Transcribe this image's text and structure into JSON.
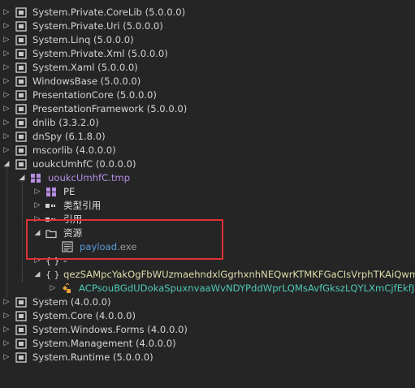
{
  "tree": {
    "assemblies_top": [
      {
        "name": "System.Private.CoreLib",
        "version": "(5.0.0.0)"
      },
      {
        "name": "System.Private.Uri",
        "version": "(5.0.0.0)"
      },
      {
        "name": "System.Linq",
        "version": "(5.0.0.0)"
      },
      {
        "name": "System.Private.Xml",
        "version": "(5.0.0.0)"
      },
      {
        "name": "System.Xaml",
        "version": "(5.0.0.0)"
      },
      {
        "name": "WindowsBase",
        "version": "(5.0.0.0)"
      },
      {
        "name": "PresentationCore",
        "version": "(5.0.0.0)"
      },
      {
        "name": "PresentationFramework",
        "version": "(5.0.0.0)"
      },
      {
        "name": "dnlib",
        "version": "(3.3.2.0)"
      },
      {
        "name": "dnSpy",
        "version": "(6.1.8.0)"
      },
      {
        "name": "mscorlib",
        "version": "(4.0.0.0)"
      }
    ],
    "target_assembly": {
      "name": "uoukcUmhfC",
      "version": "(0.0.0.0)"
    },
    "module": {
      "name": "uoukcUmhfC.tmp"
    },
    "module_children": {
      "pe": "PE",
      "type_refs": "类型引用",
      "refs": "引用",
      "resources": "资源",
      "resource_file_name": "payload",
      "resource_file_ext": ".exe",
      "ns_empty": "-",
      "ns_obfuscated": "qezSAMpcYakOgFbWUzmaehndxlGgrhxnhNEQwrKTMKFGaCIsVrphTKAiQwm",
      "class_obfuscated": "ACPsouBGdUDokaSpuxnvaaWvNDYPddWprLQMsAvfGkszLQYLXmCjfEkfJ"
    },
    "assemblies_bottom": [
      {
        "name": "System",
        "version": "(4.0.0.0)"
      },
      {
        "name": "System.Core",
        "version": "(4.0.0.0)"
      },
      {
        "name": "System.Windows.Forms",
        "version": "(4.0.0.0)"
      },
      {
        "name": "System.Management",
        "version": "(4.0.0.0)"
      },
      {
        "name": "System.Runtime",
        "version": "(5.0.0.0)"
      }
    ]
  },
  "colors": {
    "background": "#252526",
    "highlight_box": "#e03131",
    "assembly_text": "#d4d4d4",
    "module_text": "#b48ee0",
    "namespace_text": "#dcdcaa",
    "class_text": "#4ec9b0",
    "resource_text": "#569cd6"
  },
  "icons": {
    "collapsed": "triangle-right-outline",
    "expanded": "triangle-down-filled",
    "assembly": "assembly-icon",
    "module": "module-icon",
    "folder": "folder-icon",
    "namespace": "namespace-braces-icon",
    "class": "class-icon",
    "resource": "resource-file-icon"
  }
}
